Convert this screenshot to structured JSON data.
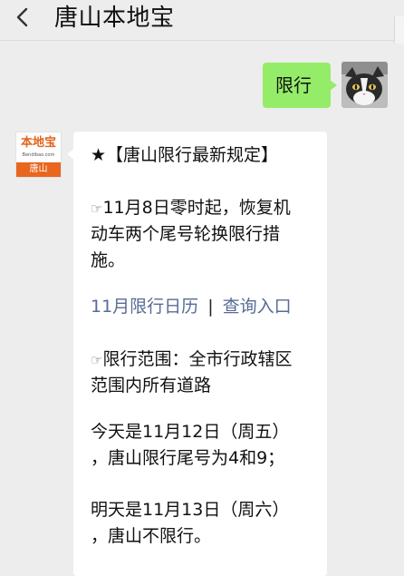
{
  "header": {
    "title": "唐山本地宝"
  },
  "outgoing": {
    "text": "限行"
  },
  "bot_avatar": {
    "brand": "本地宝",
    "url": "Bendibao.com",
    "city": "唐山"
  },
  "incoming": {
    "title": "★【唐山限行最新规定】",
    "p1_icon": "☞",
    "p1_lines": [
      "11月8日零时起，恢复机",
      "动车两个尾号轮换限行措",
      "施。"
    ],
    "link_calendar": "11月限行日历",
    "link_separator": "|",
    "link_query": "查询入口",
    "p2_icon": "☞",
    "p2_lines": [
      "限行范围：全市行政辖区",
      "范围内所有道路"
    ],
    "today_lines": [
      "今天是11月12日（周五）",
      "，唐山限行尾号为4和9；"
    ],
    "tomorrow_lines": [
      "明天是11月13日（周六）",
      "，唐山不限行。"
    ]
  },
  "colors": {
    "background": "#ededed",
    "outgoing_bubble": "#95ec69",
    "incoming_bubble": "#ffffff",
    "link": "#576b95",
    "logo_orange": "#e8661e"
  }
}
